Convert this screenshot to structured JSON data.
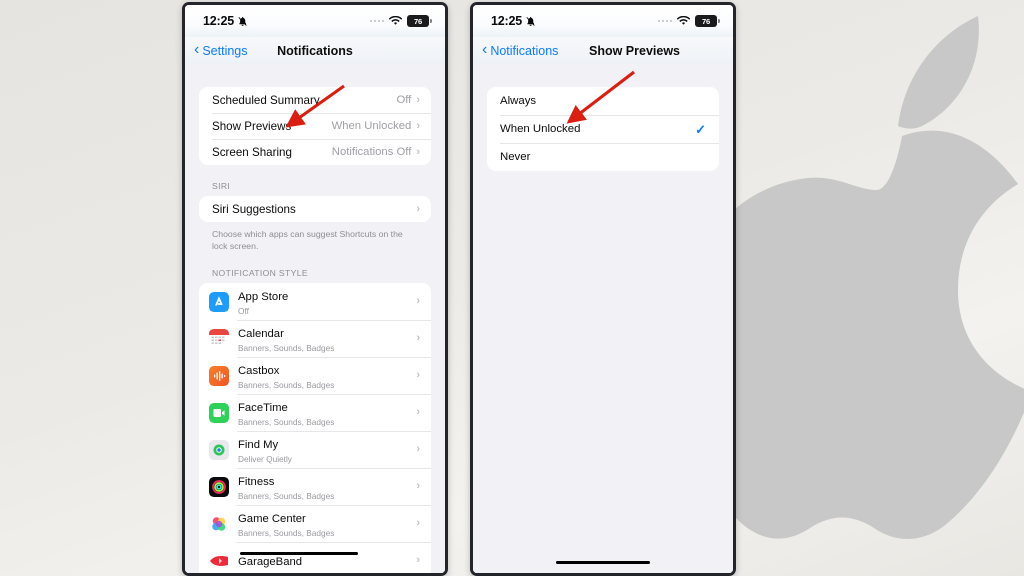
{
  "background": {
    "gradient_from": "#e6e4e0",
    "gradient_to": "#e9e7e2",
    "logo": "apple-logo",
    "logo_color": "#c9c9c9"
  },
  "accent": "#0a7cf6",
  "annotation_color": "#d91f11",
  "phone_left": {
    "status_bar": {
      "time": "12:25",
      "bell_icon": "bell-slash-icon",
      "signal_icon": "signal-dots-icon",
      "wifi_icon": "wifi-icon",
      "battery_level": "76"
    },
    "nav": {
      "back_label": "Settings",
      "title": "Notifications"
    },
    "settings_rows": [
      {
        "label": "Scheduled Summary",
        "value": "Off"
      },
      {
        "label": "Show Previews",
        "value": "When Unlocked"
      },
      {
        "label": "Screen Sharing",
        "value": "Notifications Off"
      }
    ],
    "siri_section": {
      "header": "SIRI",
      "row_label": "Siri Suggestions",
      "note": "Choose which apps can suggest Shortcuts on the lock screen."
    },
    "notification_style": {
      "header": "NOTIFICATION STYLE",
      "apps": [
        {
          "name": "App Store",
          "sub": "Off",
          "icon": "app-store-icon"
        },
        {
          "name": "Calendar",
          "sub": "Banners, Sounds, Badges",
          "icon": "calendar-icon"
        },
        {
          "name": "Castbox",
          "sub": "Banners, Sounds, Badges",
          "icon": "castbox-icon"
        },
        {
          "name": "FaceTime",
          "sub": "Banners, Sounds, Badges",
          "icon": "facetime-icon"
        },
        {
          "name": "Find My",
          "sub": "Deliver Quietly",
          "icon": "find-my-icon"
        },
        {
          "name": "Fitness",
          "sub": "Banners, Sounds, Badges",
          "icon": "fitness-icon"
        },
        {
          "name": "Game Center",
          "sub": "Banners, Sounds, Badges",
          "icon": "game-center-icon"
        },
        {
          "name": "GarageBand",
          "sub": "",
          "icon": "garageband-icon"
        }
      ]
    }
  },
  "phone_right": {
    "status_bar": {
      "time": "12:25",
      "bell_icon": "bell-slash-icon",
      "signal_icon": "signal-dots-icon",
      "wifi_icon": "wifi-icon",
      "battery_level": "76"
    },
    "nav": {
      "back_label": "Notifications",
      "title": "Show Previews"
    },
    "options": [
      {
        "label": "Always",
        "selected": false
      },
      {
        "label": "When Unlocked",
        "selected": true
      },
      {
        "label": "Never",
        "selected": false
      }
    ],
    "checkmark": "✓"
  }
}
